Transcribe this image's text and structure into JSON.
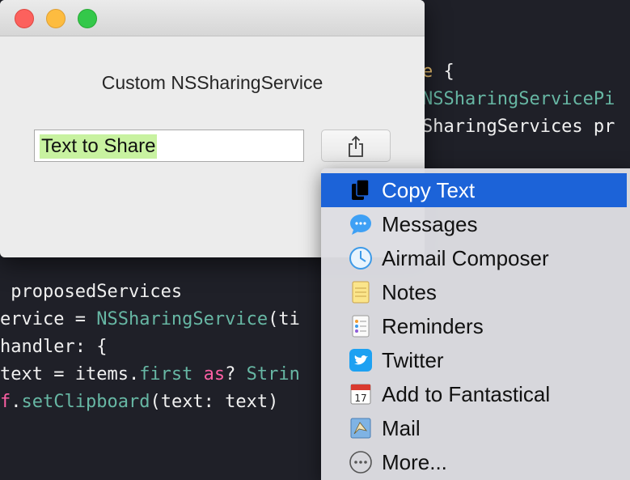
{
  "code": {
    "lines": [
      {
        "segments": [
          {
            "text": "e ",
            "cls": "kw-orange"
          },
          {
            "text": "{",
            "cls": "kw-white"
          }
        ]
      },
      {
        "segments": [
          {
            "text": "NSSharingServicePi",
            "cls": "kw-teal"
          }
        ]
      },
      {
        "segments": [
          {
            "text": "SharingServices pr",
            "cls": "kw-white"
          }
        ]
      },
      {
        "segments": [
          {
            "text": " proposedServices",
            "cls": "kw-white"
          }
        ]
      },
      {
        "segments": [
          {
            "text": "ervice = ",
            "cls": "kw-white"
          },
          {
            "text": "NSSharingService",
            "cls": "kw-teal"
          },
          {
            "text": "(ti",
            "cls": "kw-white"
          }
        ]
      },
      {
        "segments": [
          {
            "text": "handler: {",
            "cls": "kw-white"
          }
        ]
      },
      {
        "segments": [
          {
            "text": "text = items.",
            "cls": "kw-white"
          },
          {
            "text": "first",
            "cls": "kw-teal"
          },
          {
            "text": " ",
            "cls": "kw-white"
          },
          {
            "text": "as",
            "cls": "kw-pink"
          },
          {
            "text": "? ",
            "cls": "kw-white"
          },
          {
            "text": "Strin",
            "cls": "kw-teal"
          }
        ]
      },
      {
        "segments": [
          {
            "text": "f",
            "cls": "kw-pink"
          },
          {
            "text": ".",
            "cls": "kw-white"
          },
          {
            "text": "setClipboard",
            "cls": "kw-teal"
          },
          {
            "text": "(text: text)",
            "cls": "kw-white"
          }
        ]
      }
    ]
  },
  "window": {
    "title": "Custom NSSharingService",
    "text_field_value": "Text to Share"
  },
  "menu": {
    "items": [
      {
        "label": "Copy Text",
        "icon": "copy-text-icon",
        "active": true
      },
      {
        "label": "Messages",
        "icon": "messages-icon",
        "active": false
      },
      {
        "label": "Airmail Composer",
        "icon": "airmail-icon",
        "active": false
      },
      {
        "label": "Notes",
        "icon": "notes-icon",
        "active": false
      },
      {
        "label": "Reminders",
        "icon": "reminders-icon",
        "active": false
      },
      {
        "label": "Twitter",
        "icon": "twitter-icon",
        "active": false
      },
      {
        "label": "Add to Fantastical",
        "icon": "fantastical-icon",
        "active": false
      },
      {
        "label": "Mail",
        "icon": "mail-icon",
        "active": false
      },
      {
        "label": "More...",
        "icon": "more-icon",
        "active": false
      }
    ]
  },
  "colors": {
    "selection_highlight": "#c8f2a0",
    "menu_active": "#1c63d8"
  }
}
